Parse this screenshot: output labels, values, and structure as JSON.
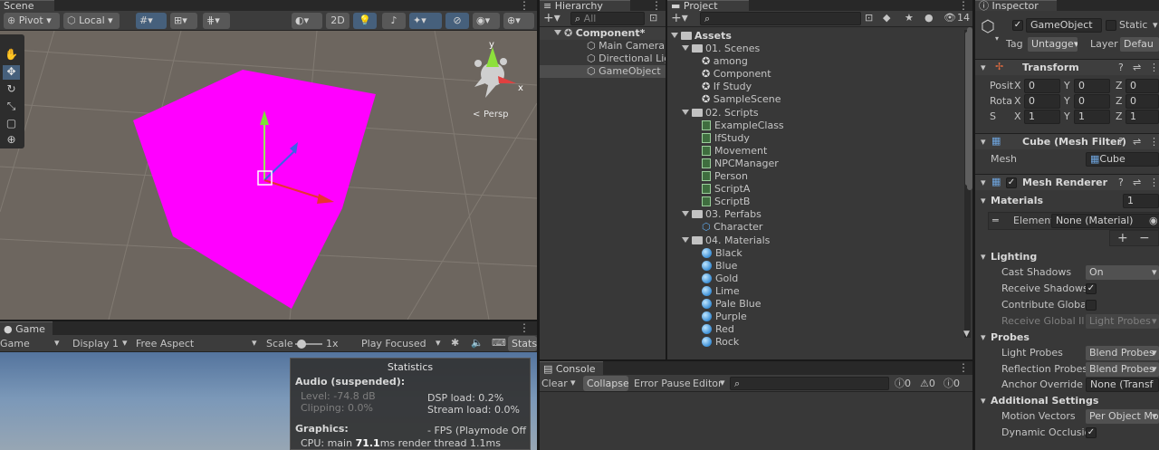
{
  "scene": {
    "tab": "Scene",
    "pivot": "Pivot",
    "local": "Local",
    "btn_2d": "2D",
    "persp": "Persp",
    "gizmo_y": "y",
    "gizmo_x": "x"
  },
  "game": {
    "tab": "Game",
    "mode": "Game",
    "display": "Display 1",
    "aspect": "Free Aspect",
    "scale_label": "Scale",
    "scale_value": "1x",
    "play_focused": "Play Focused",
    "stats": "Stats"
  },
  "statistics": {
    "title": "Statistics",
    "audio_header": "Audio (suspended):",
    "level": "Level: -74.8 dB",
    "clipping": "Clipping: 0.0%",
    "dsp": "DSP load: 0.2%",
    "stream": "Stream load: 0.0%",
    "graphics_header": "Graphics:",
    "fps": "- FPS (Playmode Off",
    "cpu_prefix": "CPU: main ",
    "cpu_main": "71.1",
    "cpu_mid": "ms  render thread ",
    "cpu_render": "1.1ms"
  },
  "hierarchy": {
    "tab": "Hierarchy",
    "search_placeholder": "All",
    "root": "Component*",
    "items": [
      "Main Camera",
      "Directional Lig",
      "GameObject"
    ]
  },
  "project": {
    "tab": "Project",
    "hidden_count": "14",
    "assets": "Assets",
    "folders": [
      {
        "name": "01. Scenes",
        "kind": "scene",
        "items": [
          "among",
          "Component",
          "If Study",
          "SampleScene"
        ]
      },
      {
        "name": "02. Scripts",
        "kind": "script",
        "items": [
          "ExampleClass",
          "IfStudy",
          "Movement",
          "NPCManager",
          "Person",
          "ScriptA",
          "ScriptB"
        ]
      },
      {
        "name": "03. Perfabs",
        "kind": "prefab",
        "items": [
          "Character"
        ]
      },
      {
        "name": "04. Materials",
        "kind": "material",
        "items": [
          "Black",
          "Blue",
          "Gold",
          "Lime",
          "Pale Blue",
          "Purple",
          "Red",
          "Rock"
        ]
      }
    ]
  },
  "console": {
    "tab": "Console",
    "clear": "Clear",
    "collapse": "Collapse",
    "error_pause": "Error Pause",
    "editor": "Editor",
    "count_info": "0",
    "count_warn": "0",
    "count_error": "0"
  },
  "inspector": {
    "tab": "Inspector",
    "object_name": "GameObject",
    "static_label": "Static",
    "tag_label": "Tag",
    "tag_value": "Untagge",
    "layer_label": "Layer",
    "layer_value": "Defau",
    "transform": {
      "title": "Transform",
      "rows": [
        {
          "label": "Posit",
          "x": "0",
          "y": "0",
          "z": "0"
        },
        {
          "label": "Rota",
          "x": "0",
          "y": "0",
          "z": "0"
        },
        {
          "label": "S",
          "x": "1",
          "y": "1",
          "z": "1"
        }
      ],
      "x_label": "X",
      "y_label": "Y",
      "z_label": "Z"
    },
    "mesh_filter": {
      "title": "Cube (Mesh Filter)",
      "mesh_label": "Mesh",
      "mesh_value": "Cube"
    },
    "mesh_renderer": {
      "title": "Mesh Renderer",
      "materials_label": "Materials",
      "materials_count": "1",
      "element_label": "Element",
      "element_value": "None (Material)",
      "plus": "+",
      "minus": "−"
    },
    "lighting": {
      "title": "Lighting",
      "cast_shadows_label": "Cast Shadows",
      "cast_shadows_value": "On",
      "receive_shadows_label": "Receive Shadows",
      "contribute_gi_label": "Contribute Global I",
      "receive_gi_label": "Receive Global Illu",
      "receive_gi_value": "Light Probes"
    },
    "probes": {
      "title": "Probes",
      "light_probes_label": "Light Probes",
      "light_probes_value": "Blend Probes",
      "reflection_probes_label": "Reflection Probes",
      "reflection_probes_value": "Blend Probes",
      "anchor_label": "Anchor Override",
      "anchor_value": "None (Transf"
    },
    "additional": {
      "title": "Additional Settings",
      "motion_label": "Motion Vectors",
      "motion_value": "Per Object Mo",
      "occlusion_label": "Dynamic Occlusio"
    }
  },
  "colors": {
    "cube": "#ff00ff",
    "selection": "#2c5d87",
    "panel_bg": "#383838",
    "toolbar_bg": "#3c3c3c",
    "accent_blue": "#46607c"
  }
}
